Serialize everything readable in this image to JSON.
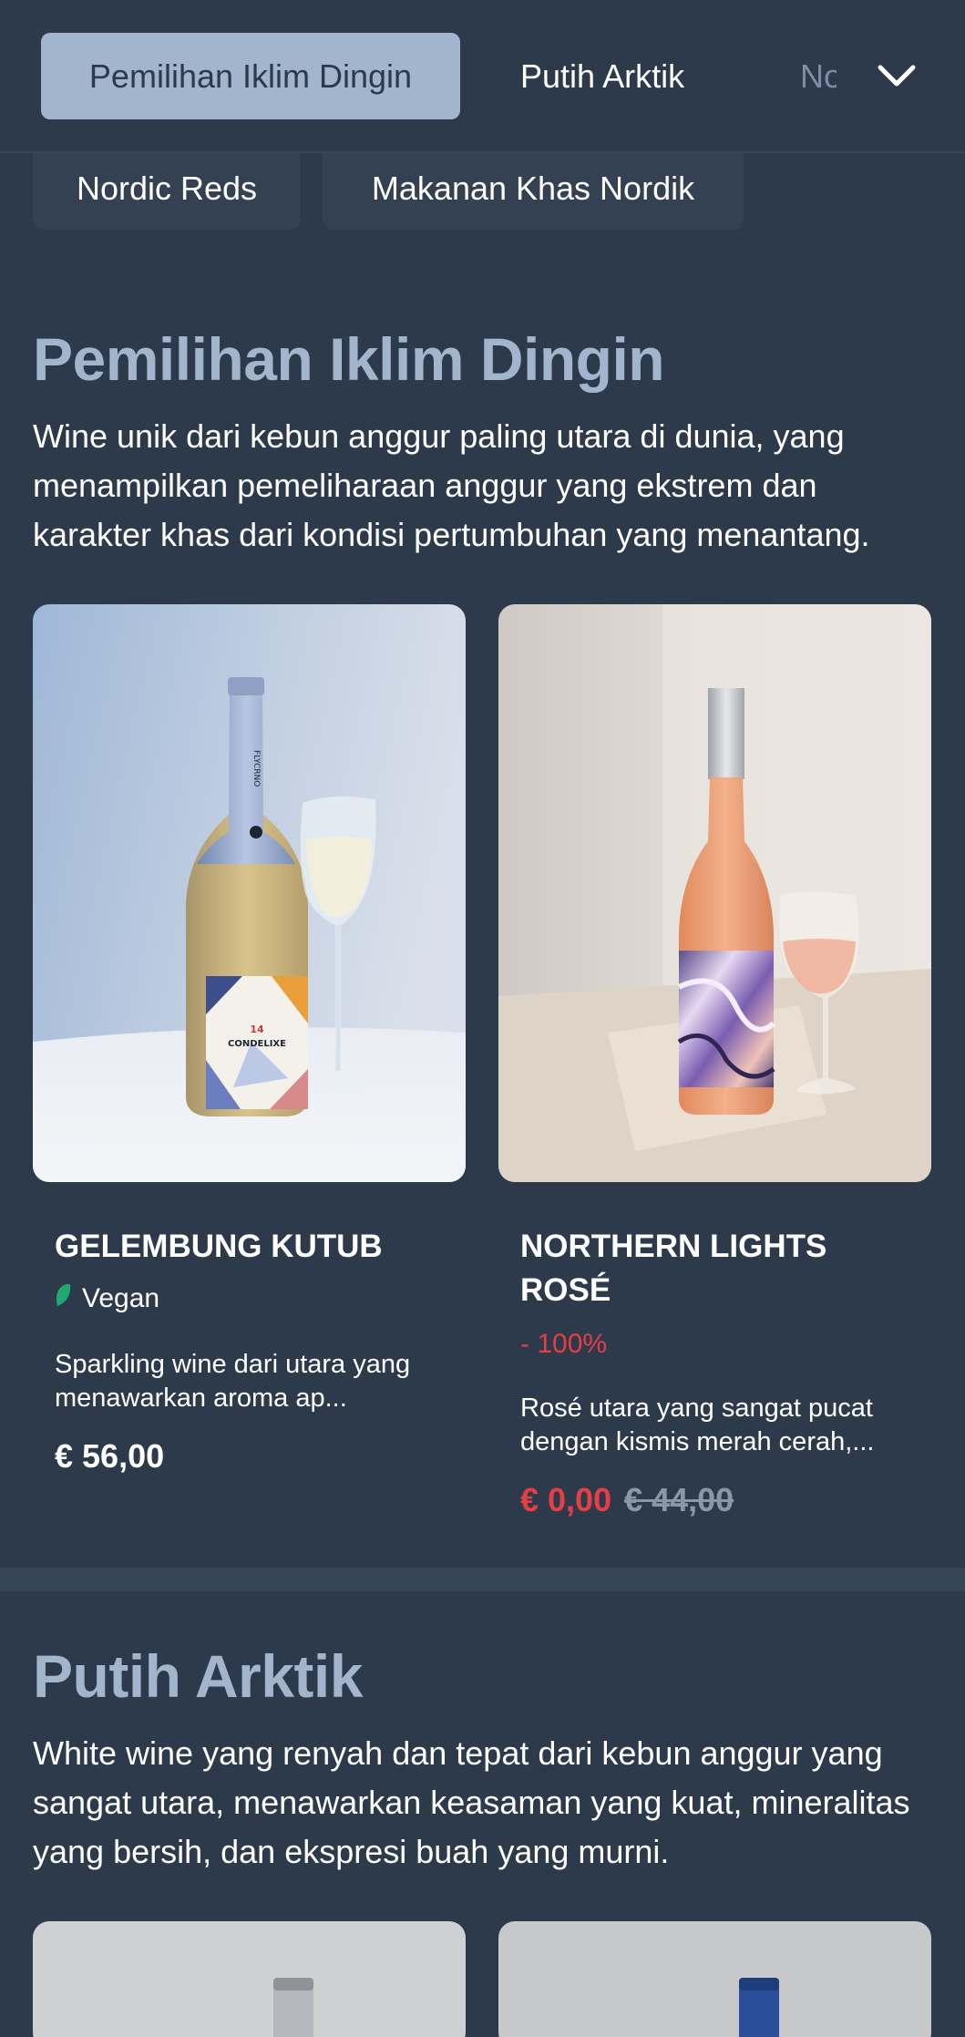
{
  "tabs": {
    "active": "Pemilihan Iklim Dingin",
    "second": "Putih Arktik",
    "third": "Nordic Reds"
  },
  "chips": [
    "Nordic Reds",
    "Makanan Khas Nordik"
  ],
  "sections": [
    {
      "title": "Pemilihan Iklim Dingin",
      "description": "Wine unik dari kebun anggur paling utara di dunia, yang menampilkan pemeliharaan anggur yang ekstrem dan karakter khas dari kondisi pertumbuhan yang menantang.",
      "products": [
        {
          "name": "GELEMBUNG KUTUB",
          "tag": "Vegan",
          "tag_icon": "leaf-icon",
          "description": "Sparkling wine dari utara yang menawarkan aroma ap...",
          "price": "€ 56,00"
        },
        {
          "name": "NORTHERN LIGHTS ROSÉ",
          "discount": "- 100%",
          "description": "Rosé utara yang sangat pucat dengan kismis merah cerah,...",
          "price": "€ 0,00",
          "old_price": "€ 44,00"
        }
      ]
    },
    {
      "title": "Putih Arktik",
      "description": "White wine yang renyah dan tepat dari kebun anggur yang sangat utara, menawarkan keasaman yang kuat, mineralitas yang bersih, dan ekspresi buah yang murni."
    }
  ],
  "bottle_label": {
    "brand": "CONDELIXE",
    "number": "14",
    "neck": "FLYCRNO"
  },
  "colors": {
    "background": "#2d3a4b",
    "accent": "#a3b5cd",
    "sale": "#e53e45",
    "vegan_leaf": "#1fa971"
  }
}
